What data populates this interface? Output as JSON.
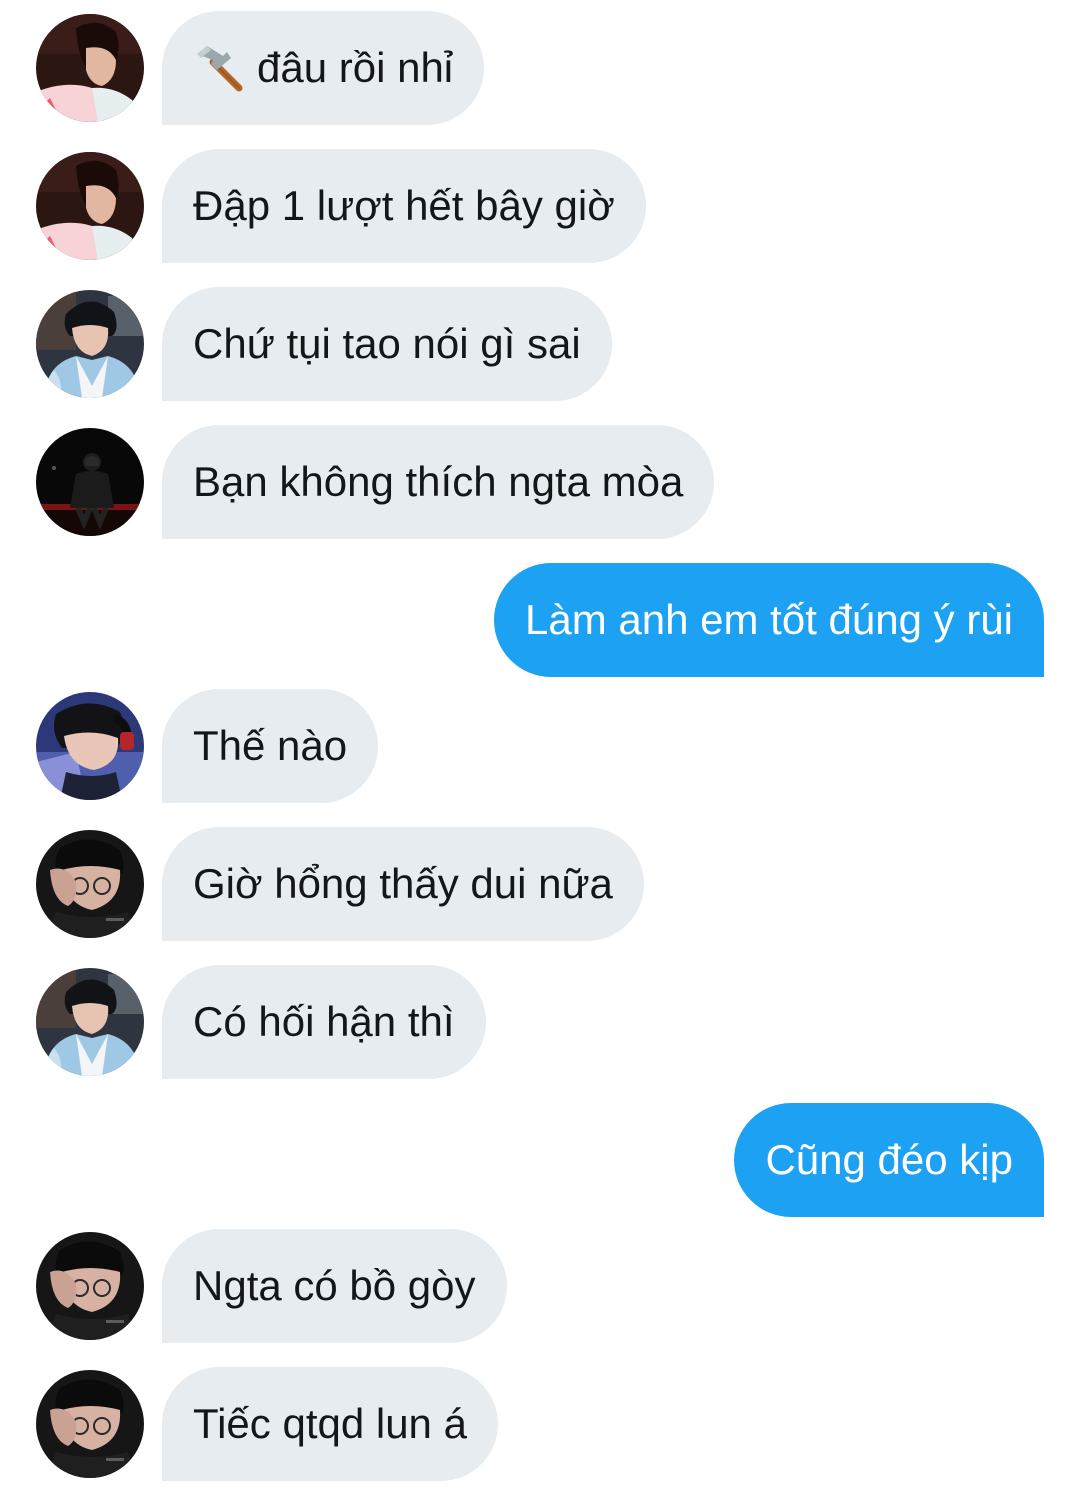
{
  "conversation": {
    "messages": [
      {
        "side": "in",
        "avatar": "avatar-pink-jacket",
        "text": "đâu rồi nhỉ",
        "icon": "hammer-icon"
      },
      {
        "side": "in",
        "avatar": "avatar-pink-jacket",
        "text": "Đập 1 lượt hết bây giờ"
      },
      {
        "side": "in",
        "avatar": "avatar-blue-hanbok",
        "text": "Chứ tụi tao nói gì sai"
      },
      {
        "side": "in",
        "avatar": "avatar-dark-stage",
        "text": "Bạn không thích ngta mòa"
      },
      {
        "side": "out",
        "text": "Làm anh em tốt đúng ý rùi"
      },
      {
        "side": "in",
        "avatar": "avatar-headset-blue-light",
        "text": "Thế nào"
      },
      {
        "side": "in",
        "avatar": "avatar-glasses-hand-face",
        "text": "Giờ hổng thấy dui nữa"
      },
      {
        "side": "in",
        "avatar": "avatar-blue-hanbok",
        "text": "Có hối hận thì"
      },
      {
        "side": "out",
        "text": "Cũng đéo kịp"
      },
      {
        "side": "in",
        "avatar": "avatar-glasses-hand-face",
        "text": "Ngta có bồ gòy"
      },
      {
        "side": "in",
        "avatar": "avatar-glasses-hand-face",
        "text": "Tiếc qtqd lun á"
      }
    ]
  },
  "colors": {
    "incoming_bubble": "#e6ecf0",
    "incoming_text": "#14171a",
    "outgoing_bubble": "#1da1f2",
    "outgoing_text": "#ffffff"
  }
}
